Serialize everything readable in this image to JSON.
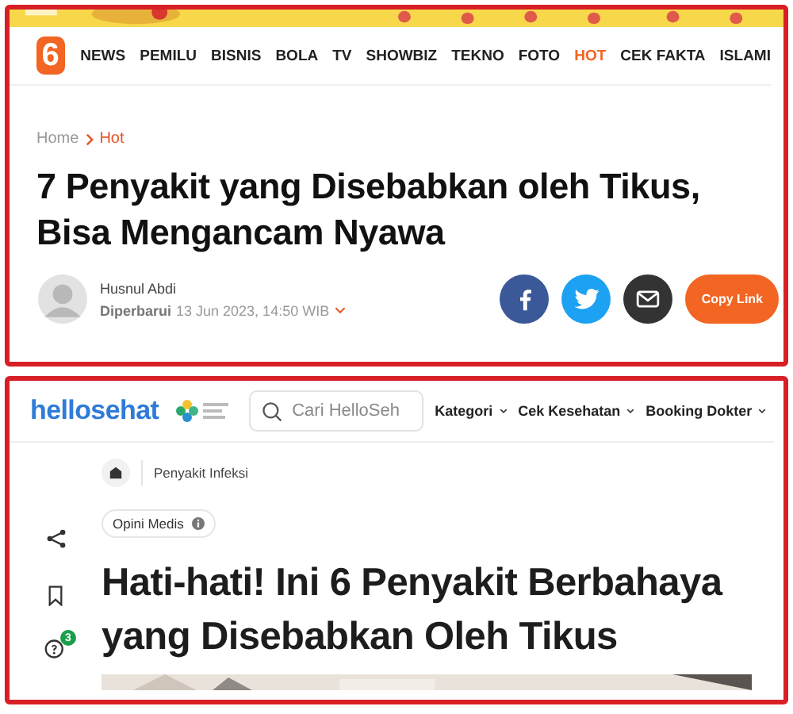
{
  "liputan6": {
    "banner": {
      "kind": "picture"
    },
    "logo": "6",
    "nav": [
      {
        "label": "NEWS",
        "selected": false
      },
      {
        "label": "PEMILU",
        "selected": false
      },
      {
        "label": "BISNIS",
        "selected": false
      },
      {
        "label": "BOLA",
        "selected": false
      },
      {
        "label": "TV",
        "selected": false
      },
      {
        "label": "SHOWBIZ",
        "selected": false
      },
      {
        "label": "TEKNO",
        "selected": false
      },
      {
        "label": "FOTO",
        "selected": false
      },
      {
        "label": "HOT",
        "selected": true
      },
      {
        "label": "CEK FAKTA",
        "selected": false
      },
      {
        "label": "ISLAMI",
        "selected": false
      }
    ],
    "breadcrumb": [
      "Home",
      "Hot"
    ],
    "title": "7 Penyakit yang Disebabkan oleh Tikus, Bisa Mengancam Nyawa",
    "author": {
      "name": "Husnul Abdi",
      "updated_label": "Diperbarui",
      "date": "13 Jun 2023, 14:50 WIB"
    },
    "share_buttons": [
      {
        "kind": "facebook"
      },
      {
        "kind": "twitter"
      },
      {
        "kind": "email"
      },
      {
        "kind": "copy",
        "label": "Copy Link"
      }
    ]
  },
  "hellosehat": {
    "logo": "hellosehat",
    "search": {
      "placeholder": "Cari HelloSeh"
    },
    "nav": [
      {
        "label": "Kategori"
      },
      {
        "label": "Cek Kesehatan"
      },
      {
        "label": "Booking Dokter"
      }
    ],
    "breadcrumb": "Penyakit Infeksi",
    "badge": "Opini Medis",
    "title": "Hati-hati! Ini 6 Penyakit Berbahaya yang Disebabkan Oleh Tikus",
    "comment_count": "3",
    "image": {
      "kind": "picture"
    }
  }
}
